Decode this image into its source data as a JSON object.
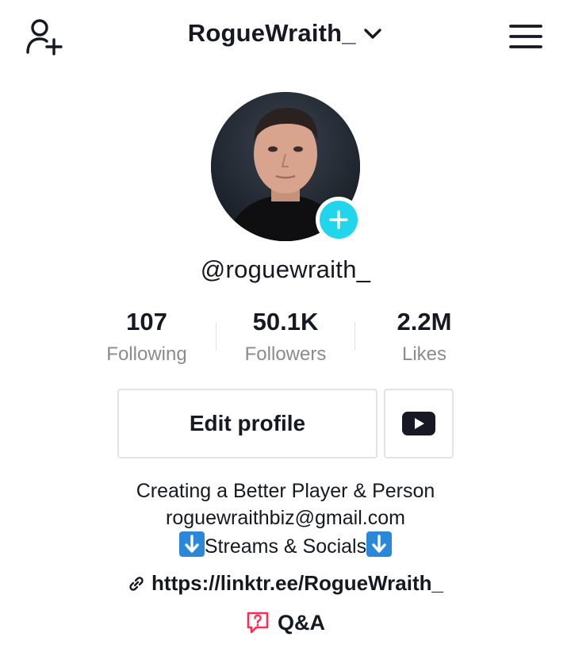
{
  "header": {
    "username": "RogueWraith_",
    "icons": {
      "add_user": "add-user-icon",
      "dropdown": "chevron-down-icon",
      "menu": "hamburger-menu-icon"
    }
  },
  "profile": {
    "handle": "@roguewraith_",
    "avatar_badge": "plus-icon"
  },
  "stats": [
    {
      "value": "107",
      "label": "Following"
    },
    {
      "value": "50.1K",
      "label": "Followers"
    },
    {
      "value": "2.2M",
      "label": "Likes"
    }
  ],
  "actions": {
    "edit_profile_label": "Edit profile",
    "youtube_icon": "youtube-icon"
  },
  "bio": {
    "line1": "Creating a Better Player & Person",
    "line2": "roguewraithbiz@gmail.com",
    "line3_text": "Streams & Socials",
    "line3_emoji": "down-arrow-emoji"
  },
  "link": {
    "url": "https://linktr.ee/RogueWraith_",
    "icon": "link-icon"
  },
  "qa": {
    "label": "Q&A",
    "icon": "question-bubble-icon"
  },
  "colors": {
    "accent_cyan": "#20d5ec",
    "qa_red": "#fe2c55",
    "text_primary": "#161823",
    "text_secondary": "#8a8b91",
    "border": "#e3e3e4",
    "emoji_blue": "#2b88d9"
  }
}
